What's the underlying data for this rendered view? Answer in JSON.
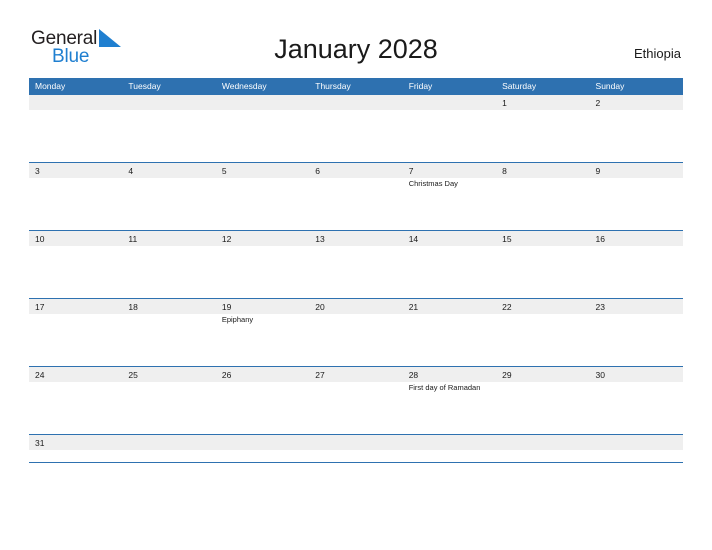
{
  "brand": {
    "name_primary": "General",
    "name_secondary": "Blue",
    "flag_icon": "triangle-flag-icon",
    "color_primary": "#231f20",
    "color_secondary": "#1f7fd0"
  },
  "header": {
    "title": "January 2028",
    "country": "Ethiopia"
  },
  "theme": {
    "header_blue": "#2e71b0",
    "date_band_gray": "#efefef",
    "text_dark": "#1a1a1a",
    "white": "#ffffff"
  },
  "calendar": {
    "month": "January",
    "year": "2028",
    "weekday_headers": [
      "Monday",
      "Tuesday",
      "Wednesday",
      "Thursday",
      "Friday",
      "Saturday",
      "Sunday"
    ],
    "weeks": [
      {
        "days": [
          {
            "date": "",
            "events": []
          },
          {
            "date": "",
            "events": []
          },
          {
            "date": "",
            "events": []
          },
          {
            "date": "",
            "events": []
          },
          {
            "date": "",
            "events": []
          },
          {
            "date": "1",
            "events": []
          },
          {
            "date": "2",
            "events": []
          }
        ]
      },
      {
        "days": [
          {
            "date": "3",
            "events": []
          },
          {
            "date": "4",
            "events": []
          },
          {
            "date": "5",
            "events": []
          },
          {
            "date": "6",
            "events": []
          },
          {
            "date": "7",
            "events": [
              "Christmas Day"
            ]
          },
          {
            "date": "8",
            "events": []
          },
          {
            "date": "9",
            "events": []
          }
        ]
      },
      {
        "days": [
          {
            "date": "10",
            "events": []
          },
          {
            "date": "11",
            "events": []
          },
          {
            "date": "12",
            "events": []
          },
          {
            "date": "13",
            "events": []
          },
          {
            "date": "14",
            "events": []
          },
          {
            "date": "15",
            "events": []
          },
          {
            "date": "16",
            "events": []
          }
        ]
      },
      {
        "days": [
          {
            "date": "17",
            "events": []
          },
          {
            "date": "18",
            "events": []
          },
          {
            "date": "19",
            "events": [
              "Epiphany"
            ]
          },
          {
            "date": "20",
            "events": []
          },
          {
            "date": "21",
            "events": []
          },
          {
            "date": "22",
            "events": []
          },
          {
            "date": "23",
            "events": []
          }
        ]
      },
      {
        "days": [
          {
            "date": "24",
            "events": []
          },
          {
            "date": "25",
            "events": []
          },
          {
            "date": "26",
            "events": []
          },
          {
            "date": "27",
            "events": []
          },
          {
            "date": "28",
            "events": [
              "First day of Ramadan"
            ]
          },
          {
            "date": "29",
            "events": []
          },
          {
            "date": "30",
            "events": []
          }
        ]
      },
      {
        "short": true,
        "days": [
          {
            "date": "31",
            "events": []
          },
          {
            "date": "",
            "events": []
          },
          {
            "date": "",
            "events": []
          },
          {
            "date": "",
            "events": []
          },
          {
            "date": "",
            "events": []
          },
          {
            "date": "",
            "events": []
          },
          {
            "date": "",
            "events": []
          }
        ]
      }
    ]
  }
}
